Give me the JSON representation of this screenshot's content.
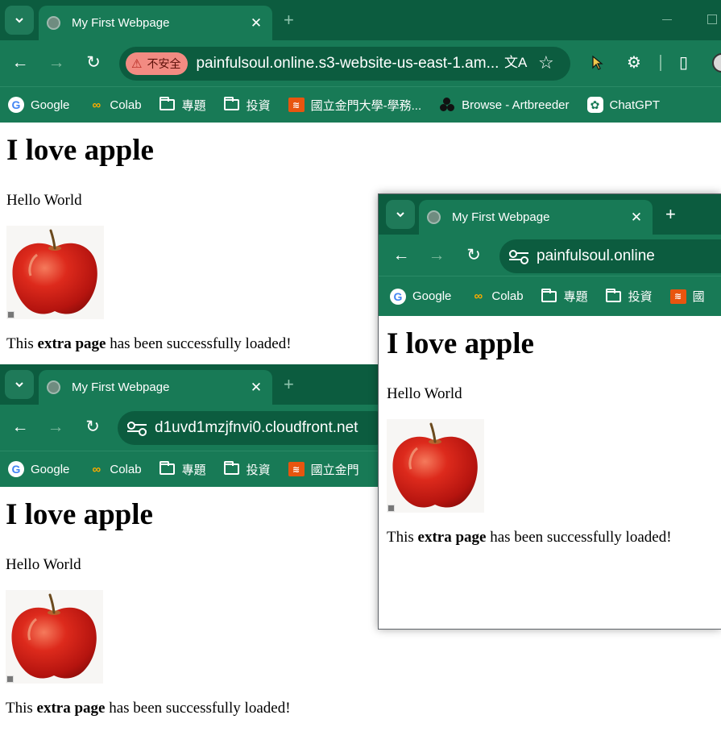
{
  "tab": {
    "title": "My First Webpage",
    "close": "✕",
    "new_tab": "+"
  },
  "windows": {
    "main": {
      "url": "painfulsoul.online.s3-website-us-east-1.am...",
      "security_label": "不安全"
    },
    "bottom": {
      "url": "d1uvd1mzjfnvi0.cloudfront.net"
    },
    "overlay": {
      "url": "painfulsoul.online"
    }
  },
  "nav": {
    "back": "←",
    "forward": "→",
    "reload": "↻",
    "star": "☆",
    "extensions": "⚙",
    "sidepanel": "▯"
  },
  "bookmarks": [
    {
      "label": "Google",
      "icon": "google-icon"
    },
    {
      "label": "Colab",
      "icon": "colab-icon"
    },
    {
      "label": "專題",
      "icon": "folder-icon"
    },
    {
      "label": "投資",
      "icon": "folder-icon"
    },
    {
      "label": "國立金門大學-學務...",
      "icon": "nqu-icon"
    },
    {
      "label": "Browse - Artbreeder",
      "icon": "artbreeder-icon"
    },
    {
      "label": "ChatGPT",
      "icon": "chatgpt-icon"
    }
  ],
  "bookmarks_truncated": {
    "overlay_fifth": "國",
    "bottom_fifth": "國立金門"
  },
  "page": {
    "heading": "I love apple",
    "hello": "Hello World",
    "loaded_before": "This ",
    "loaded_bold": "extra page",
    "loaded_after": " has been successfully loaded!"
  }
}
